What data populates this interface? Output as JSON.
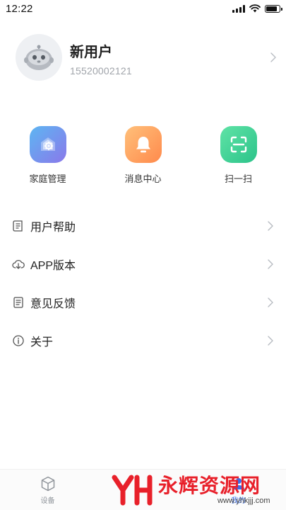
{
  "status_bar": {
    "time": "12:22"
  },
  "profile": {
    "name": "新用户",
    "phone": "15520002121"
  },
  "quick_actions": [
    {
      "label": "家庭管理",
      "icon": "home-gear-icon"
    },
    {
      "label": "消息中心",
      "icon": "bell-icon"
    },
    {
      "label": "扫一扫",
      "icon": "scan-icon"
    }
  ],
  "menu": [
    {
      "label": "用户帮助",
      "icon": "help-doc-icon"
    },
    {
      "label": "APP版本",
      "icon": "cloud-download-icon"
    },
    {
      "label": "意见反馈",
      "icon": "feedback-doc-icon"
    },
    {
      "label": "关于",
      "icon": "info-icon"
    }
  ],
  "tabbar": {
    "devices_label": "设备",
    "mine_label": "我的"
  },
  "watermark": {
    "logo": "YH",
    "text": "永辉资源网",
    "url": "www.yhkjjj.com"
  },
  "colors": {
    "accent": "#3a6ee8",
    "watermark": "#e8202a"
  }
}
